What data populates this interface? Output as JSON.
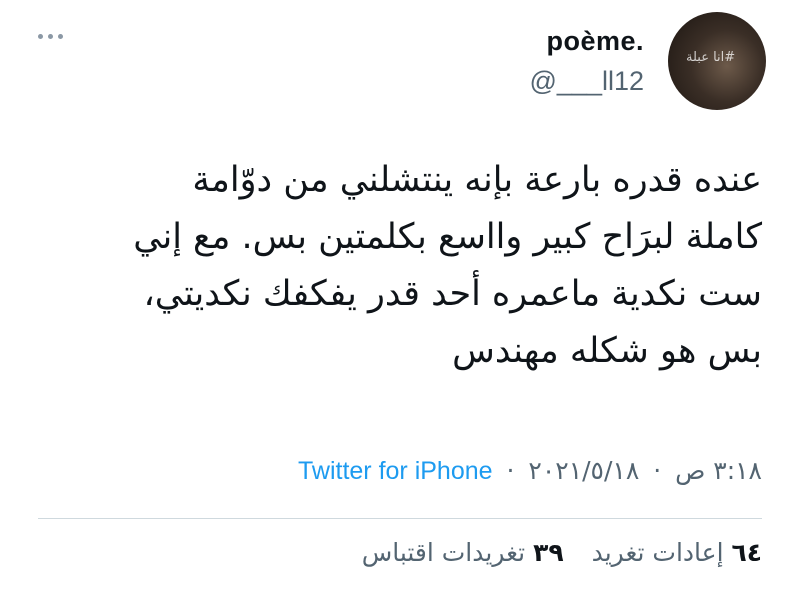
{
  "author": {
    "name": "poème.",
    "handle": "@___ll12",
    "avatar_overlay_text": "#انا عبلة"
  },
  "tweet": {
    "lines": [
      "عنده قدره بارعة بإنه ينتشلني من دوّامة",
      "كاملة لبرَاح كبير وااسع بكلمتين بس. مع إني",
      "ست نكدية ماعمره أحد قدر يفكفك نكديتي،",
      "بس هو شكله مهندس"
    ]
  },
  "meta": {
    "time": "٣:١٨ ص",
    "date": "٢٠٢١/٥/١٨",
    "separator": "·",
    "source": "Twitter for iPhone"
  },
  "stats": {
    "retweets_count": "٦٤",
    "retweets_label": "إعادات تغريد",
    "quotes_count": "٣٩",
    "quotes_label": "تغريدات اقتباس"
  },
  "colors": {
    "accent": "#1d9bf0",
    "muted": "#536471",
    "text": "#0f1419",
    "divider": "#cfd9de"
  },
  "icons": {
    "more": "more-horizontal-icon"
  }
}
